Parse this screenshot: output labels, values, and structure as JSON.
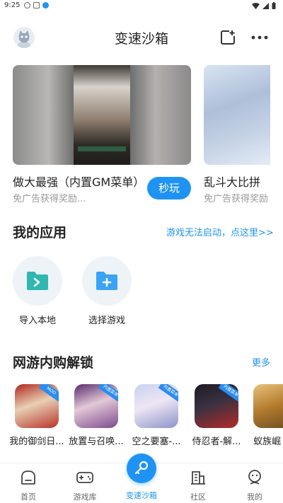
{
  "status": {
    "time": "9:25"
  },
  "header": {
    "title": "变速沙箱"
  },
  "featured": [
    {
      "title": "做大最强（内置GM菜单）",
      "subtitle": "免广告获得奖励...",
      "button": "秒玩"
    },
    {
      "title": "乱斗大比拼",
      "subtitle": "免广告获得奖励"
    }
  ],
  "my_apps": {
    "title": "我的应用",
    "help_link": "游戏无法启动，点这里>>",
    "items": [
      {
        "label": "导入本地"
      },
      {
        "label": "选择游戏"
      }
    ]
  },
  "unlock": {
    "title": "网游内购解锁",
    "more": "更多",
    "games": [
      {
        "name": "我的御剑日...",
        "tag": "MOD"
      },
      {
        "name": "放置与召唤...",
        "tag": "内置菜单"
      },
      {
        "name": "空之要塞-...",
        "tag": "内置菜单"
      },
      {
        "name": "侍忍者-解...",
        "tag": "内置菜单"
      },
      {
        "name": "蚁族崛"
      }
    ]
  },
  "nav": [
    {
      "label": "首页"
    },
    {
      "label": "游戏库"
    },
    {
      "label": "变速沙箱"
    },
    {
      "label": "社区"
    },
    {
      "label": "我的"
    }
  ],
  "colors": {
    "accent": "#1f93f3",
    "folder": "#3aa3f5",
    "import_folder": "#2fb7b0"
  }
}
